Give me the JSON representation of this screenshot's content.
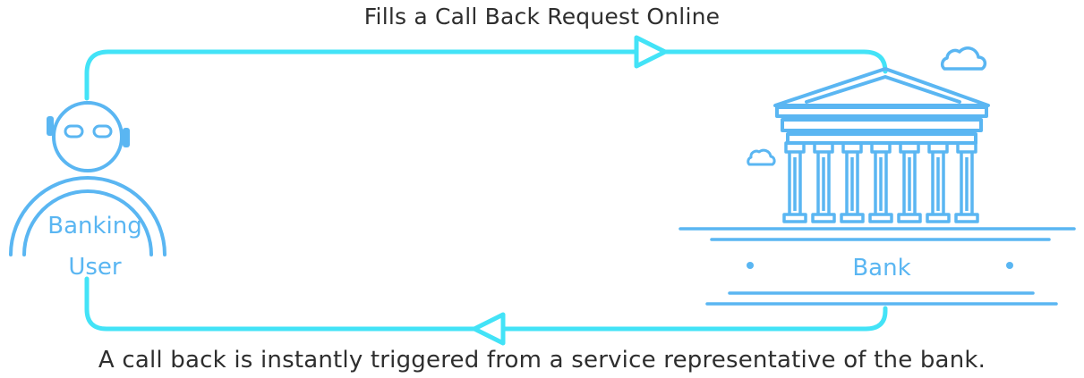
{
  "flow": {
    "request_label": "Fills a Call Back Request Online",
    "response_label": "A call back is instantly triggered from a service representative of the bank."
  },
  "actors": {
    "user": {
      "line1": "Banking",
      "line2": "User"
    },
    "bank": {
      "label": "Bank"
    }
  },
  "colors": {
    "flow_line": "#43e3f7",
    "icon_line": "#5ab6f2",
    "caption_text": "#2e2e2e"
  }
}
